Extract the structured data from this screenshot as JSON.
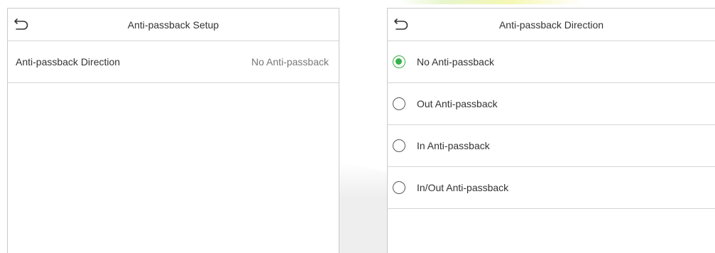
{
  "colors": {
    "accent": "#37b14a",
    "divider": "#d6d6d6",
    "border": "#c9c9c9",
    "text": "#333333",
    "muted": "#777777"
  },
  "left_screen": {
    "back_icon": "undo-arrow-icon",
    "title": "Anti-passback Setup",
    "rows": [
      {
        "label": "Anti-passback Direction",
        "value": "No Anti-passback"
      }
    ]
  },
  "right_screen": {
    "back_icon": "undo-arrow-icon",
    "title": "Anti-passback Direction",
    "selected_option": "No Anti-passback",
    "options": [
      {
        "label": "No Anti-passback",
        "checked": true
      },
      {
        "label": "Out Anti-passback",
        "checked": false
      },
      {
        "label": "In Anti-passback",
        "checked": false
      },
      {
        "label": "In/Out Anti-passback",
        "checked": false
      }
    ]
  }
}
